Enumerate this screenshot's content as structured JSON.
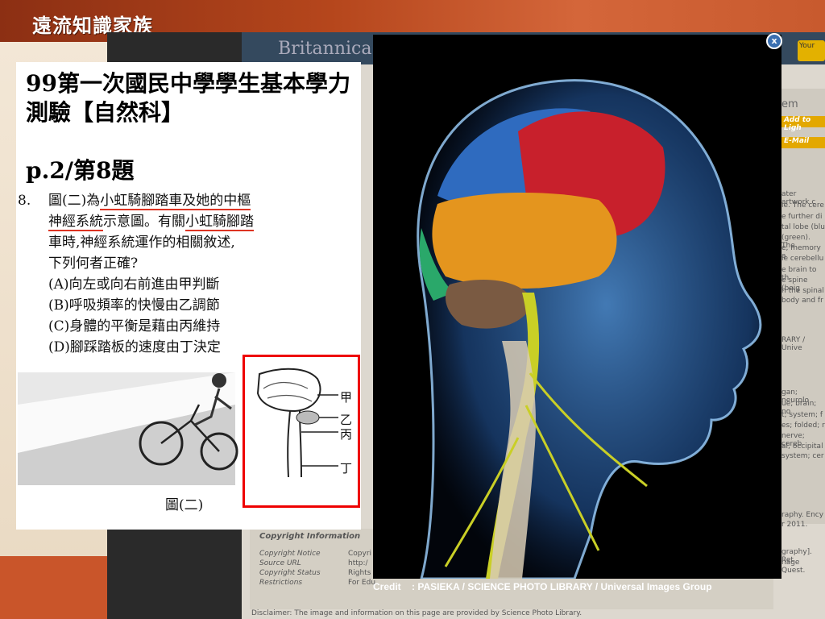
{
  "header": {
    "logo_text": "遠流知識家族"
  },
  "britannica": {
    "logo": "Britannica",
    "button_text": "Your",
    "side_item": "em",
    "side_buttons": [
      "Add to Ligh",
      "E-Mail"
    ],
    "side_texts": [
      "ater artwork c",
      "ie. The cere",
      "e further di",
      "tal lobe (blu",
      "(green). The",
      "e, memory a",
      "ie cerebellu",
      "e brain to th",
      "e spine (beig",
      "h the spinal",
      "body and fr",
      "RARY / Unive",
      "gan; neurolo",
      "ue; brain; no",
      "t; system; f",
      "es; folded; r",
      "nerve; cereb",
      "al; occipital",
      "system; cer",
      "raphy. Ency",
      "r 2011.",
      "graphy]. Ret",
      "nage Quest."
    ],
    "copyright_title": "Copyright Information",
    "copyright_rows": [
      {
        "label": "Copyright Notice",
        "value": "Copyri"
      },
      {
        "label": "Source URL",
        "value": "http:/"
      },
      {
        "label": "Copyright Status",
        "value": "Rights"
      },
      {
        "label": "Restrictions",
        "value": "For Edu"
      }
    ],
    "disclaimer": "Disclaimer: The image and information on this page are provided by Science Photo Library."
  },
  "image": {
    "close_label": "x",
    "credit": "Credit    : PASIEKA / SCIENCE PHOTO LIBRARY / Universal Images Group"
  },
  "card": {
    "title": "99第一次國民中學學生基本學力測驗【自然科】",
    "page": "p.2/第8題",
    "question_number": "8.",
    "question_lines": [
      {
        "pre": "圖(二)為",
        "u": "小虹騎腳踏車及她的",
        "u2": "中樞"
      },
      {
        "pre": "",
        "u": "神經系統",
        "post": "示意圖。有關",
        "u2": "小虹騎腳踏"
      },
      {
        "text": "車時,神經系統運作的相關敘述,"
      },
      {
        "text": "下列何者正確?"
      }
    ],
    "options": [
      "(A)向左或向右前進由甲判斷",
      "(B)呼吸頻率的快慢由乙調節",
      "(C)身體的平衡是藉由丙維持",
      "(D)腳踩踏板的速度由丁決定"
    ],
    "brain_labels": [
      "甲",
      "乙",
      "丙",
      "丁"
    ],
    "figure_caption": "圖(二)"
  },
  "colors": {
    "accent_red": "#e00000",
    "band_orange": "#c85a2e"
  }
}
